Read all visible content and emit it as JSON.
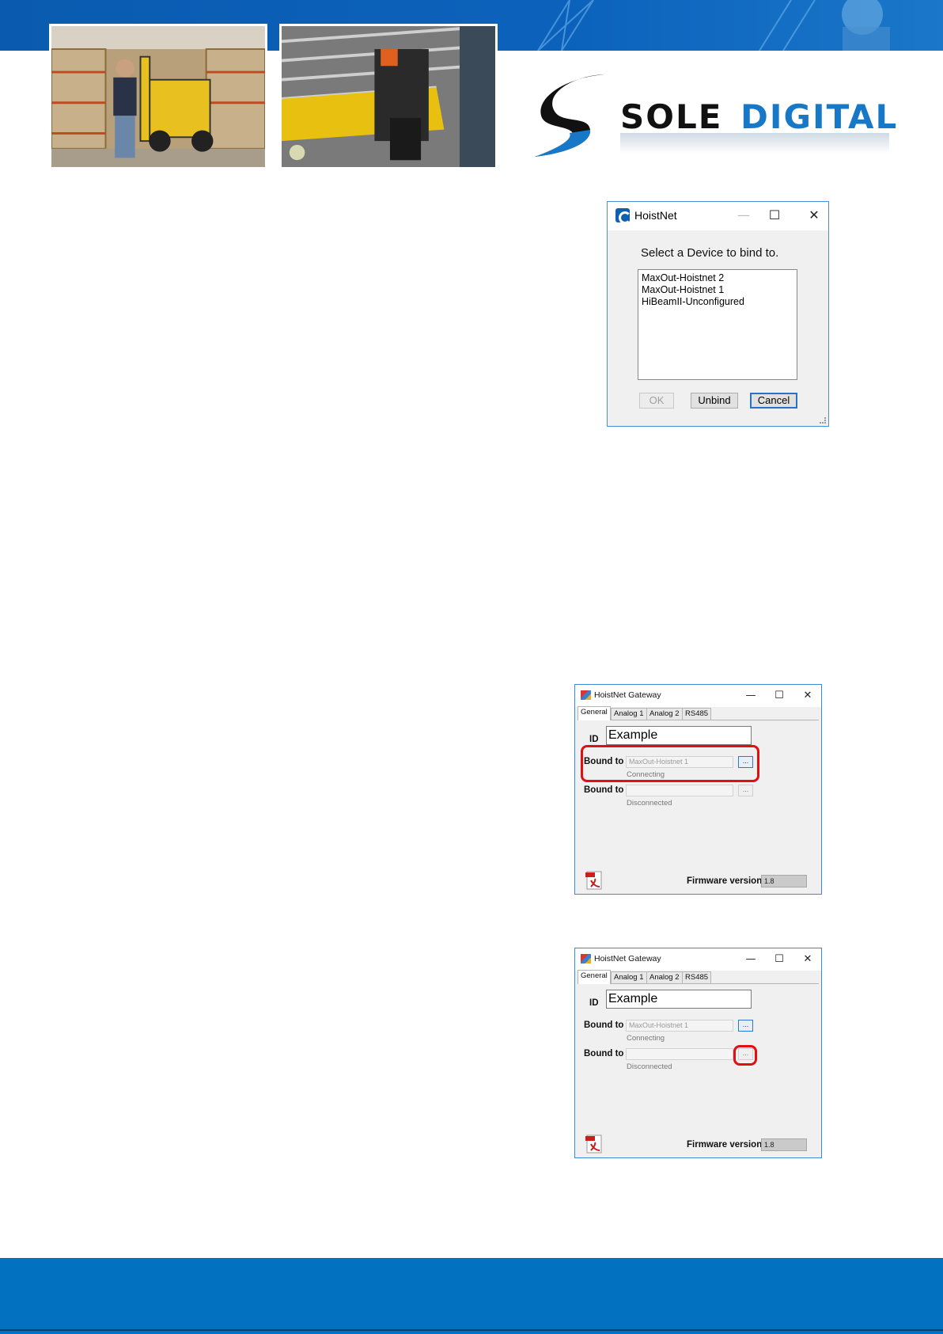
{
  "brand": {
    "word_1": "SOLE",
    "word_2": "DIGITAL",
    "colors": {
      "primary_blue": "#0271c0",
      "header_blue": "#0c62bb",
      "logo_blue": "#1878c8",
      "highlight_red": "#e01010"
    }
  },
  "photos": [
    {
      "description_icon": "warehouse-forklift-photo"
    },
    {
      "description_icon": "overhead-crane-hoist-photo"
    }
  ],
  "bind_dialog": {
    "title": "HoistNet",
    "prompt": "Select a Device to bind to.",
    "devices": [
      "MaxOut-Hoistnet 2",
      "MaxOut-Hoistnet 1",
      "HiBeamII-Unconfigured"
    ],
    "buttons": {
      "ok": "OK",
      "unbind": "Unbind",
      "cancel": "Cancel"
    },
    "ok_disabled": true
  },
  "gateway_windows": [
    {
      "title": "HoistNet Gateway",
      "tabs": [
        "General",
        "Analog 1",
        "Analog 2",
        "RS485"
      ],
      "active_tab": "General",
      "id_label": "ID",
      "id_value": "Example",
      "bindings": [
        {
          "label": "Bound to",
          "value": "MaxOut-Hoistnet 1",
          "status": "Connecting"
        },
        {
          "label": "Bound to",
          "value": "",
          "status": "Disconnected"
        }
      ],
      "firmware_label": "Firmware version",
      "firmware_value": "1.8",
      "highlighted": "first-binding-row"
    },
    {
      "title": "HoistNet Gateway",
      "tabs": [
        "General",
        "Analog 1",
        "Analog 2",
        "RS485"
      ],
      "active_tab": "General",
      "id_label": "ID",
      "id_value": "Example",
      "bindings": [
        {
          "label": "Bound to",
          "value": "MaxOut-Hoistnet 1",
          "status": "Connecting"
        },
        {
          "label": "Bound to",
          "value": "",
          "status": "Disconnected"
        }
      ],
      "firmware_label": "Firmware version",
      "firmware_value": "1.8",
      "highlighted": "second-binding-browse-button"
    }
  ],
  "window_controls": {
    "minimize": "—",
    "maximize": "☐",
    "close": "✕"
  },
  "browse_button_label": "..."
}
